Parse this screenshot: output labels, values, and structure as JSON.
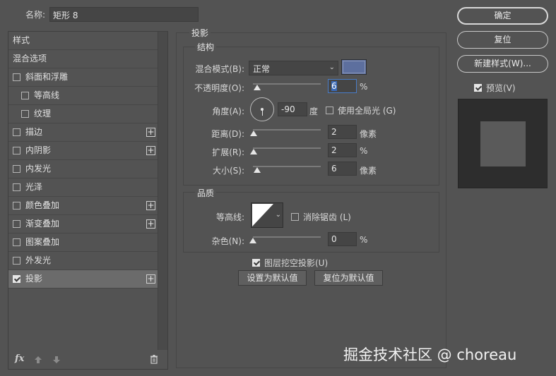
{
  "name_row": {
    "label": "名称:",
    "value": "矩形 8"
  },
  "styles_list": {
    "items": [
      {
        "label": "样式",
        "checkbox": false,
        "checked": false,
        "plus": false,
        "indent": false,
        "selected": false
      },
      {
        "label": "混合选项",
        "checkbox": false,
        "checked": false,
        "plus": false,
        "indent": false,
        "selected": false
      },
      {
        "label": "斜面和浮雕",
        "checkbox": true,
        "checked": false,
        "plus": false,
        "indent": false,
        "selected": false
      },
      {
        "label": "等高线",
        "checkbox": true,
        "checked": false,
        "plus": false,
        "indent": true,
        "selected": false
      },
      {
        "label": "纹理",
        "checkbox": true,
        "checked": false,
        "plus": false,
        "indent": true,
        "selected": false
      },
      {
        "label": "描边",
        "checkbox": true,
        "checked": false,
        "plus": true,
        "indent": false,
        "selected": false
      },
      {
        "label": "内阴影",
        "checkbox": true,
        "checked": false,
        "plus": true,
        "indent": false,
        "selected": false
      },
      {
        "label": "内发光",
        "checkbox": true,
        "checked": false,
        "plus": false,
        "indent": false,
        "selected": false
      },
      {
        "label": "光泽",
        "checkbox": true,
        "checked": false,
        "plus": false,
        "indent": false,
        "selected": false
      },
      {
        "label": "颜色叠加",
        "checkbox": true,
        "checked": false,
        "plus": true,
        "indent": false,
        "selected": false
      },
      {
        "label": "渐变叠加",
        "checkbox": true,
        "checked": false,
        "plus": true,
        "indent": false,
        "selected": false
      },
      {
        "label": "图案叠加",
        "checkbox": true,
        "checked": false,
        "plus": false,
        "indent": false,
        "selected": false
      },
      {
        "label": "外发光",
        "checkbox": true,
        "checked": false,
        "plus": false,
        "indent": false,
        "selected": false
      },
      {
        "label": "投影",
        "checkbox": true,
        "checked": true,
        "plus": true,
        "indent": false,
        "selected": true
      }
    ],
    "footer": {
      "fx_label": "fx"
    }
  },
  "drop_shadow": {
    "title": "投影",
    "structure": {
      "title": "结构",
      "blend_mode_label": "混合模式(B):",
      "blend_mode_value": "正常",
      "shadow_color": "#5d6f9e",
      "opacity_label": "不透明度(O):",
      "opacity_value": "6",
      "opacity_unit": "%",
      "opacity_level": 0.06,
      "angle_label": "角度(A):",
      "angle_value": "-90",
      "angle_unit": "度",
      "global_light_label": "使用全局光 (G)",
      "global_light_checked": false,
      "distance_label": "距离(D):",
      "distance_value": "2",
      "distance_unit": "像素",
      "spread_label": "扩展(R):",
      "spread_value": "2",
      "spread_unit": "%",
      "size_label": "大小(S):",
      "size_value": "6",
      "size_unit": "像素"
    },
    "quality": {
      "title": "品质",
      "contour_label": "等高线:",
      "antialias_label": "消除锯齿 (L)",
      "antialias_checked": false,
      "noise_label": "杂色(N):",
      "noise_value": "0",
      "noise_unit": "%"
    },
    "knockout_label": "图层挖空投影(U)",
    "knockout_checked": true,
    "make_default_label": "设置为默认值",
    "reset_default_label": "复位为默认值"
  },
  "right_panel": {
    "ok_label": "确定",
    "reset_label": "复位",
    "new_style_label": "新建样式(W)...",
    "preview_label": "预览(V)",
    "preview_checked": true
  },
  "watermark": "掘金技术社区 @ choreau"
}
